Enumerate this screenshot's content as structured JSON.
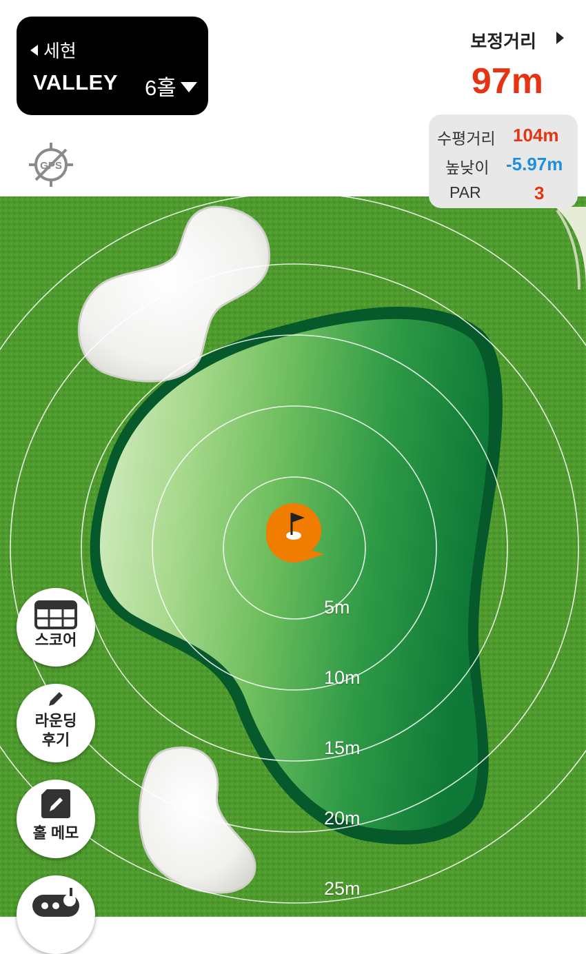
{
  "header": {
    "back_label": "세현",
    "course_name": "VALLEY",
    "hole_label": "6홀"
  },
  "adjusted_distance": {
    "label": "보정거리",
    "value": "97m"
  },
  "info": {
    "horizontal_label": "수평거리",
    "horizontal_value": "104m",
    "elevation_label": "높낮이",
    "elevation_value": "-5.97m",
    "par_label": "PAR",
    "par_value": "3"
  },
  "gps": {
    "label": "GPS"
  },
  "rings": [
    "5m",
    "10m",
    "15m",
    "20m",
    "25m"
  ],
  "side_buttons": {
    "score": "스코어",
    "review_line1": "라운딩",
    "review_line2": "후기",
    "memo": "홀 메모"
  },
  "colors": {
    "accent_red": "#e63312",
    "accent_blue": "#1e8fe0",
    "pin_orange": "#f07d00"
  }
}
